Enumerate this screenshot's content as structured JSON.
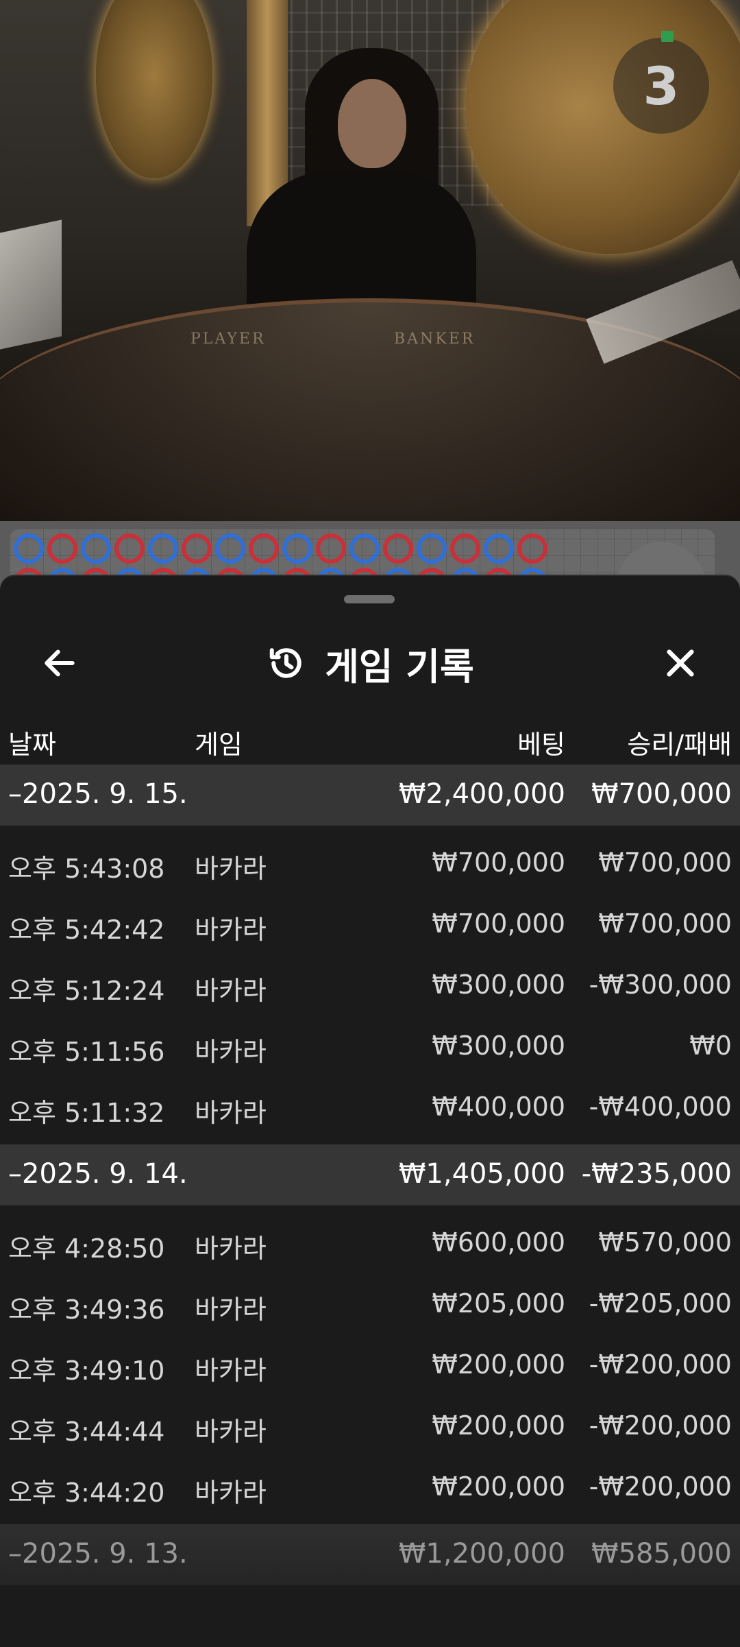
{
  "video": {
    "countdown": "3",
    "table_labels": {
      "player": "PLAYER",
      "banker": "BANKER"
    }
  },
  "road": {
    "beads": [
      "blue",
      "red",
      "blue",
      "red",
      "blue",
      "red",
      "blue",
      "red",
      "blue",
      "red",
      "blue",
      "red",
      "blue",
      "red",
      "blue",
      "red"
    ]
  },
  "sheet": {
    "title": "게임 기록",
    "icons": {
      "back": "arrow-left-icon",
      "history": "history-icon",
      "close": "close-icon"
    },
    "columns": {
      "date": "날짜",
      "game": "게임",
      "bet": "베팅",
      "win_loss": "승리/패배"
    },
    "days": [
      {
        "date": "–2025. 9. 15.",
        "bet_total": "₩2,400,000",
        "win_loss_total": "₩700,000",
        "entries": [
          {
            "time": "오후 5:43:08",
            "game": "바카라",
            "bet": "₩700,000",
            "win_loss": "₩700,000"
          },
          {
            "time": "오후 5:42:42",
            "game": "바카라",
            "bet": "₩700,000",
            "win_loss": "₩700,000"
          },
          {
            "time": "오후 5:12:24",
            "game": "바카라",
            "bet": "₩300,000",
            "win_loss": "-₩300,000"
          },
          {
            "time": "오후 5:11:56",
            "game": "바카라",
            "bet": "₩300,000",
            "win_loss": "₩0"
          },
          {
            "time": "오후 5:11:32",
            "game": "바카라",
            "bet": "₩400,000",
            "win_loss": "-₩400,000"
          }
        ]
      },
      {
        "date": "–2025. 9. 14.",
        "bet_total": "₩1,405,000",
        "win_loss_total": "-₩235,000",
        "entries": [
          {
            "time": "오후 4:28:50",
            "game": "바카라",
            "bet": "₩600,000",
            "win_loss": "₩570,000"
          },
          {
            "time": "오후 3:49:36",
            "game": "바카라",
            "bet": "₩205,000",
            "win_loss": "-₩205,000"
          },
          {
            "time": "오후 3:49:10",
            "game": "바카라",
            "bet": "₩200,000",
            "win_loss": "-₩200,000"
          },
          {
            "time": "오후 3:44:44",
            "game": "바카라",
            "bet": "₩200,000",
            "win_loss": "-₩200,000"
          },
          {
            "time": "오후 3:44:20",
            "game": "바카라",
            "bet": "₩200,000",
            "win_loss": "-₩200,000"
          }
        ]
      },
      {
        "date": "–2025. 9. 13.",
        "bet_total": "₩1,200,000",
        "win_loss_total": "₩585,000",
        "entries": []
      }
    ]
  },
  "colors": {
    "sheet_bg": "#1b1b1b",
    "day_row_bg": "#363636",
    "bead_blue": "#2f6fd6",
    "bead_red": "#c8303a"
  }
}
